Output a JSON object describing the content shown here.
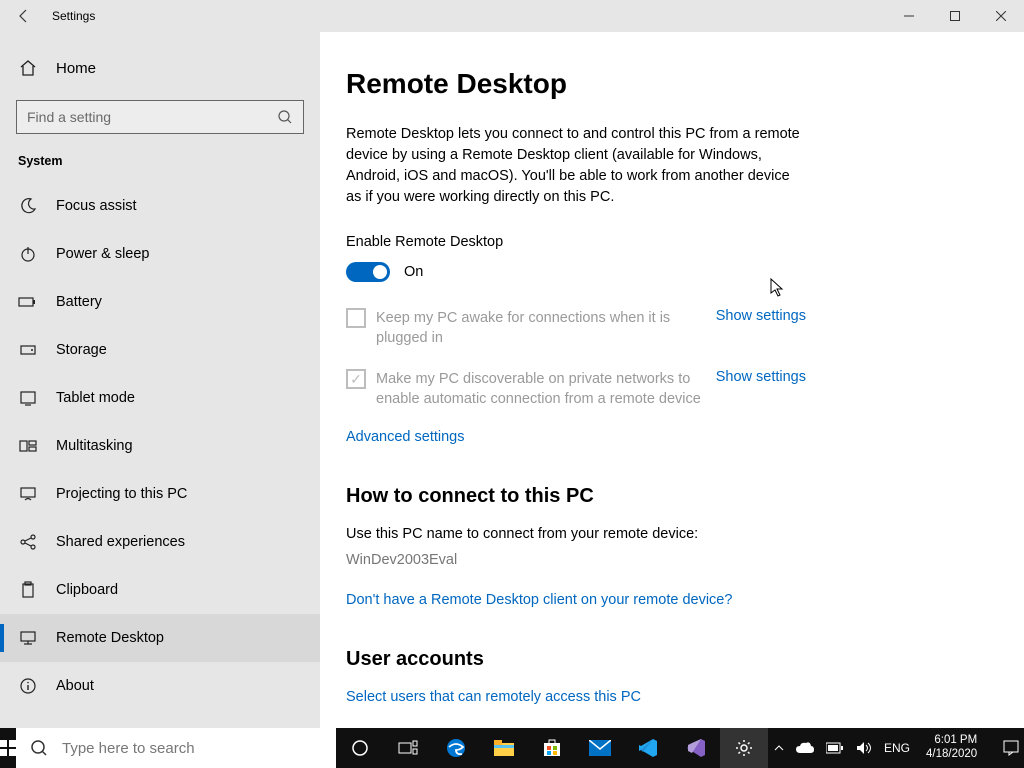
{
  "window": {
    "title": "Settings"
  },
  "sidebar": {
    "home": "Home",
    "search_placeholder": "Find a setting",
    "group": "System",
    "items": [
      {
        "label": "Focus assist"
      },
      {
        "label": "Power & sleep"
      },
      {
        "label": "Battery"
      },
      {
        "label": "Storage"
      },
      {
        "label": "Tablet mode"
      },
      {
        "label": "Multitasking"
      },
      {
        "label": "Projecting to this PC"
      },
      {
        "label": "Shared experiences"
      },
      {
        "label": "Clipboard"
      },
      {
        "label": "Remote Desktop",
        "selected": true
      },
      {
        "label": "About"
      }
    ]
  },
  "main": {
    "title": "Remote Desktop",
    "desc": "Remote Desktop lets you connect to and control this PC from a remote device by using a Remote Desktop client (available for Windows, Android, iOS and macOS). You'll be able to work from another device as if you were working directly on this PC.",
    "enable_label": "Enable Remote Desktop",
    "toggle_state": "On",
    "sub1_text": "Keep my PC awake for connections when it is plugged in",
    "sub1_link": "Show settings",
    "sub2_text": "Make my PC discoverable on private networks to enable automatic connection from a remote device",
    "sub2_link": "Show settings",
    "advanced": "Advanced settings",
    "howto_title": "How to connect to this PC",
    "howto_line": "Use this PC name to connect from your remote device:",
    "pc_name": "WinDev2003Eval",
    "client_link": "Don't have a Remote Desktop client on your remote device?",
    "ua_title": "User accounts",
    "ua_link": "Select users that can remotely access this PC"
  },
  "taskbar": {
    "search_placeholder": "Type here to search",
    "lang": "ENG",
    "time": "6:01 PM",
    "date": "4/18/2020"
  }
}
